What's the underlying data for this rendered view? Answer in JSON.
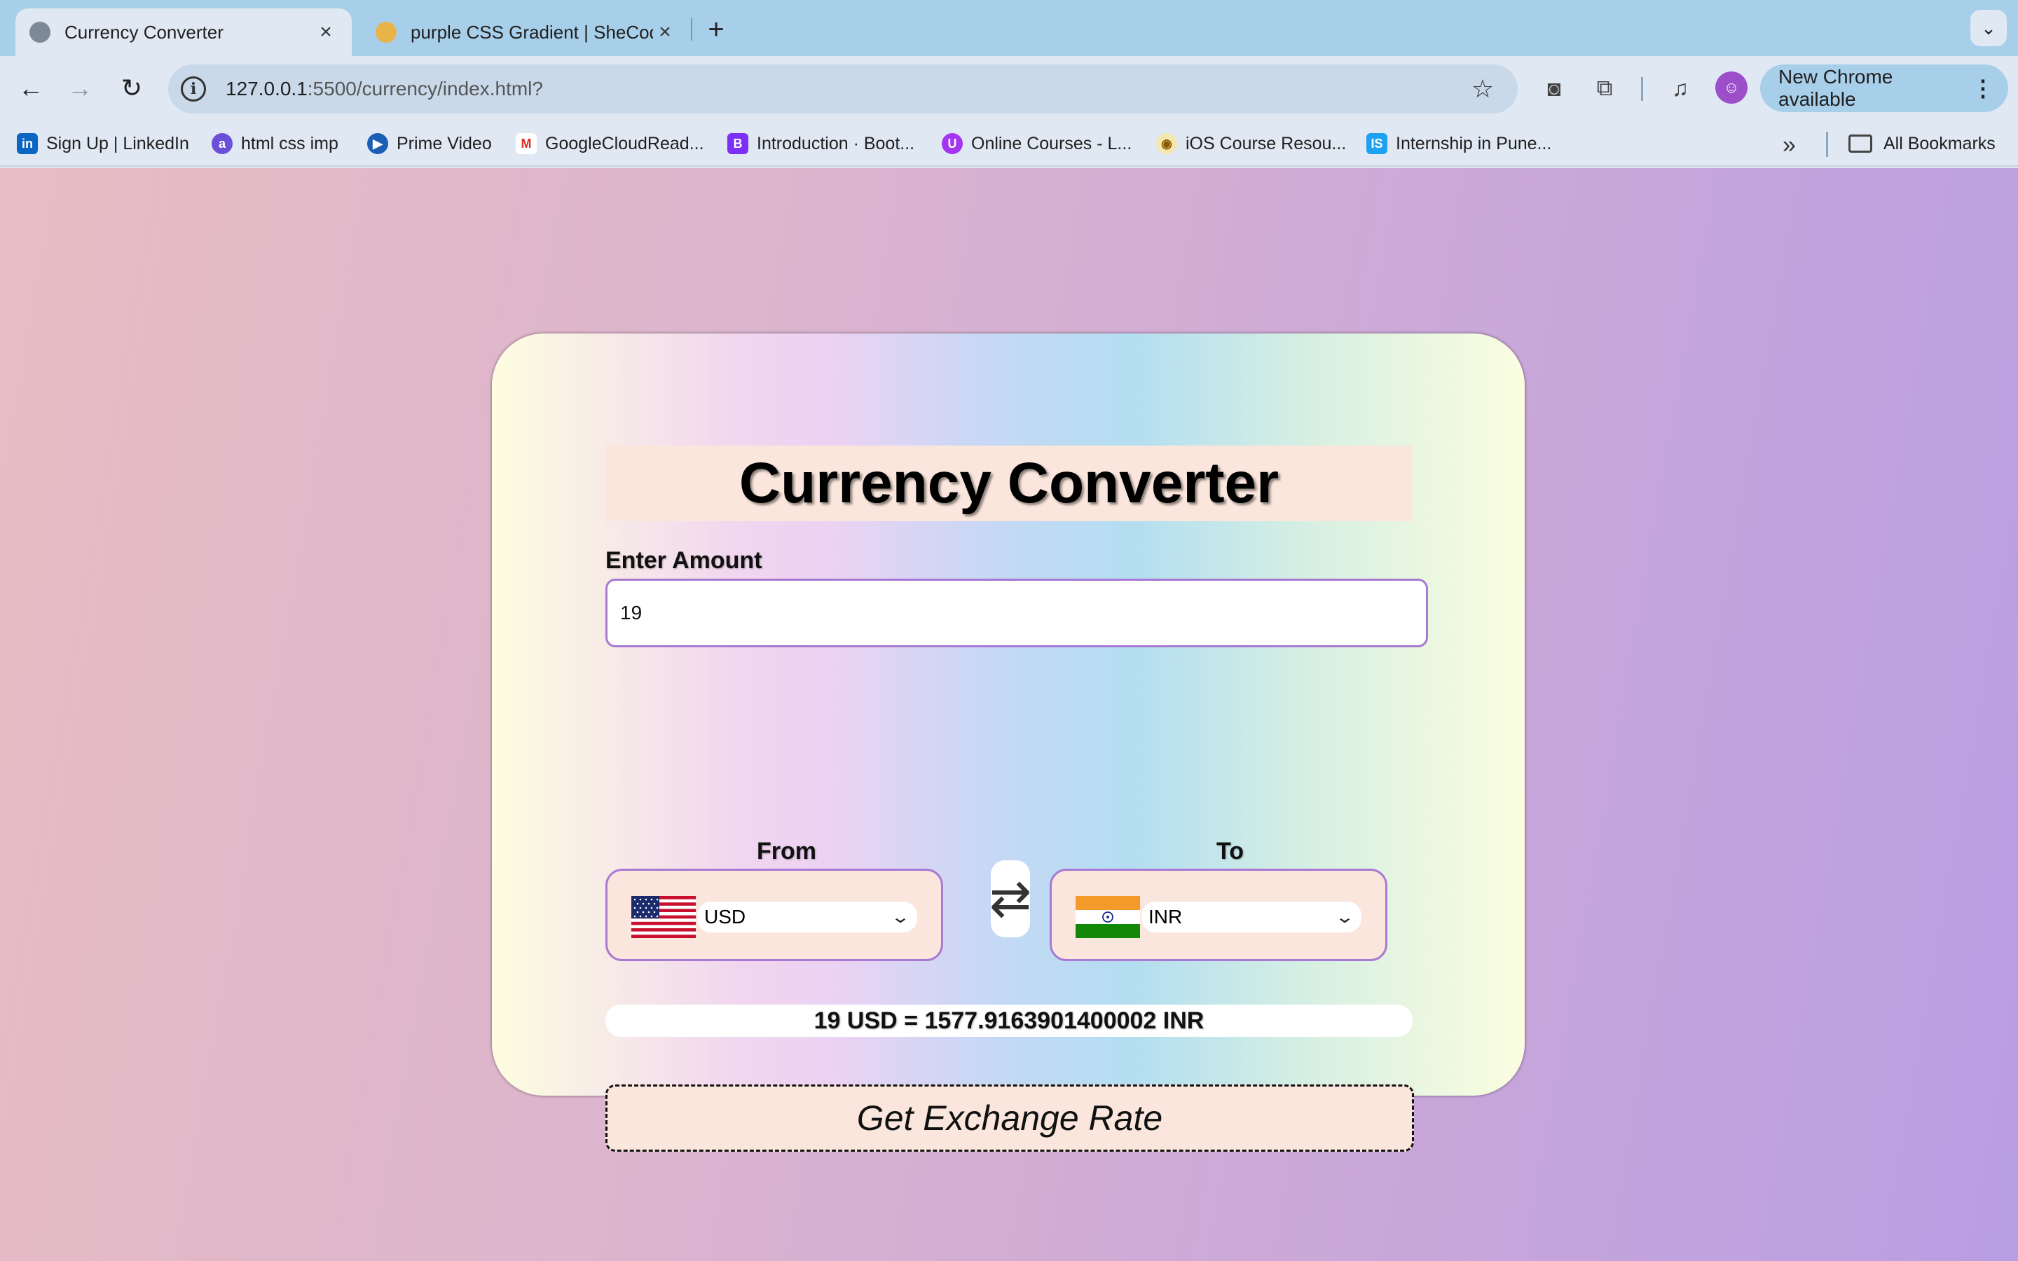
{
  "browser": {
    "tabs": [
      {
        "title": "Currency Converter",
        "active": true,
        "favicon": "globe-icon"
      },
      {
        "title": "purple CSS Gradient | SheCodes",
        "active": false,
        "favicon": "shecodes-icon"
      }
    ],
    "address": {
      "host": "127.0.0.1",
      "path": ":5500/currency/index.html?"
    },
    "new_chrome_label": "New Chrome available",
    "bookmarks": [
      {
        "label": "Sign Up | LinkedIn",
        "icon": "linkedin-icon",
        "color": "#0a66c2"
      },
      {
        "label": "html css imp",
        "icon": "a-icon",
        "color": "#6b4fd8"
      },
      {
        "label": "Prime Video",
        "icon": "play-icon",
        "color": "#1a5fb4"
      },
      {
        "label": "GoogleCloudRead...",
        "icon": "gmail-icon",
        "color": "#d93025"
      },
      {
        "label": "Introduction · Boot...",
        "icon": "bootstrap-icon",
        "color": "#7b2ff7"
      },
      {
        "label": "Online Courses - L...",
        "icon": "udemy-icon",
        "color": "#a435f0"
      },
      {
        "label": "iOS Course Resou...",
        "icon": "ios-course-icon",
        "color": "#e0a400"
      },
      {
        "label": "Internship in Pune...",
        "icon": "internshala-icon",
        "color": "#1da1f2"
      }
    ],
    "all_bookmarks_label": "All Bookmarks"
  },
  "converter": {
    "title": "Currency Converter",
    "amount_label": "Enter Amount",
    "amount_value": "19",
    "from_label": "From",
    "to_label": "To",
    "from_currency": "USD",
    "to_currency": "INR",
    "result_text": "19 USD = 1577.9163901400002 INR",
    "button_label": "Get Exchange Rate"
  },
  "colors": {
    "accent_border": "#a87ad3",
    "panel": "#fae6dc",
    "background_start": "#e8bcc3",
    "background_end": "#b89ee3"
  }
}
